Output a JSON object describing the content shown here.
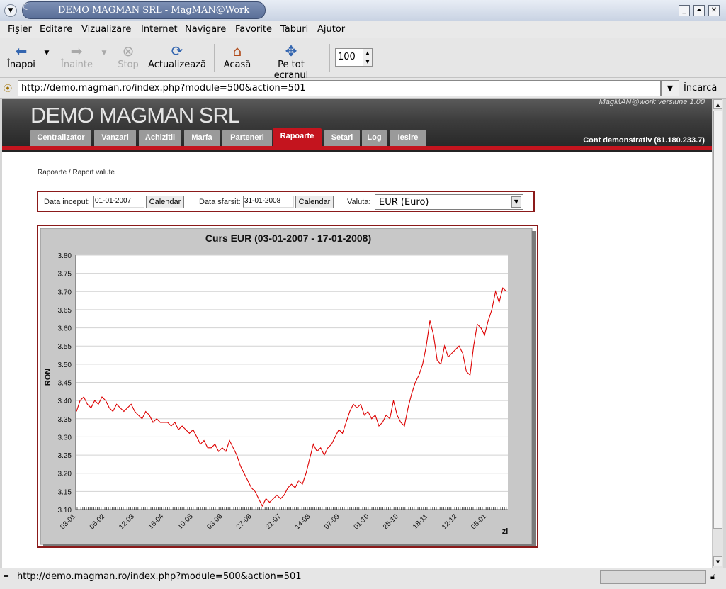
{
  "window": {
    "title": "DEMO MAGMAN SRL - MagMAN@Work",
    "menu_button": "▼",
    "controls": [
      "_",
      "⏶",
      "✕"
    ]
  },
  "menubar": {
    "items": [
      "Fişier",
      "Editare",
      "Vizualizare",
      "Internet",
      "Navigare",
      "Favorite",
      "Taburi",
      "Ajutor"
    ]
  },
  "toolbar": {
    "back_label": "Înapoi",
    "forward_label": "Înainte",
    "stop_label": "Stop",
    "reload_label": "Actualizează",
    "home_label": "Acasă",
    "fullscreen_label": "Pe tot ecranul",
    "zoom_value": "100"
  },
  "address": {
    "url": "http://demo.magman.ro/index.php?module=500&action=501",
    "load_label": "Încarcă"
  },
  "site": {
    "title": "DEMO MAGMAN SRL",
    "version": "MagMAN@work versiune 1.00",
    "account": "Cont demonstrativ (81.180.233.7)",
    "tabs": [
      "Centralizator",
      "Vanzari",
      "Achizitii",
      "Marfa",
      "Parteneri",
      "Rapoarte",
      "Setari",
      "Log",
      "Iesire"
    ],
    "active_tab": "Rapoarte"
  },
  "breadcrumb": "Rapoarte / Raport valute",
  "filter": {
    "start_label": "Data inceput:",
    "start_value": "01-01-2007",
    "end_label": "Data sfarsit:",
    "end_value": "31-01-2008",
    "calendar_label": "Calendar",
    "currency_label": "Valuta:",
    "currency_value": "EUR (Euro)"
  },
  "status": {
    "text": "http://demo.magman.ro/index.php?module=500&action=501"
  },
  "colors": {
    "accent_red": "#c4141e",
    "line": "#dd0000"
  },
  "chart_data": {
    "type": "line",
    "title": "Curs EUR (03-01-2007 - 17-01-2008)",
    "ylabel": "RON",
    "xlabel": "zi",
    "ylim": [
      3.1,
      3.8
    ],
    "yticks": [
      3.1,
      3.15,
      3.2,
      3.25,
      3.3,
      3.35,
      3.4,
      3.45,
      3.5,
      3.55,
      3.6,
      3.65,
      3.7,
      3.75,
      3.8
    ],
    "grid": true,
    "x_tick_labels": [
      "03-01",
      "06-02",
      "12-03",
      "16-04",
      "10-05",
      "03-06",
      "27-06",
      "21-07",
      "14-08",
      "07-09",
      "01-10",
      "25-10",
      "18-11",
      "12-12",
      "05-01"
    ],
    "series": [
      {
        "values": [
          3.37,
          3.4,
          3.41,
          3.39,
          3.38,
          3.4,
          3.39,
          3.41,
          3.4,
          3.38,
          3.37,
          3.39,
          3.38,
          3.37,
          3.38,
          3.39,
          3.37,
          3.36,
          3.35,
          3.37,
          3.36,
          3.34,
          3.35,
          3.34,
          3.34,
          3.34,
          3.33,
          3.34,
          3.32,
          3.33,
          3.32,
          3.31,
          3.32,
          3.3,
          3.28,
          3.29,
          3.27,
          3.27,
          3.28,
          3.26,
          3.27,
          3.26,
          3.29,
          3.27,
          3.25,
          3.22,
          3.2,
          3.18,
          3.16,
          3.15,
          3.13,
          3.11,
          3.13,
          3.12,
          3.13,
          3.14,
          3.13,
          3.14,
          3.16,
          3.17,
          3.16,
          3.18,
          3.17,
          3.2,
          3.24,
          3.28,
          3.26,
          3.27,
          3.25,
          3.27,
          3.28,
          3.3,
          3.32,
          3.31,
          3.34,
          3.37,
          3.39,
          3.38,
          3.39,
          3.36,
          3.37,
          3.35,
          3.36,
          3.33,
          3.34,
          3.36,
          3.35,
          3.4,
          3.36,
          3.34,
          3.33,
          3.38,
          3.42,
          3.45,
          3.47,
          3.5,
          3.55,
          3.62,
          3.58,
          3.51,
          3.5,
          3.55,
          3.52,
          3.53,
          3.54,
          3.55,
          3.53,
          3.48,
          3.47,
          3.55,
          3.61,
          3.6,
          3.58,
          3.62,
          3.65,
          3.7,
          3.67,
          3.71,
          3.7
        ]
      }
    ]
  }
}
